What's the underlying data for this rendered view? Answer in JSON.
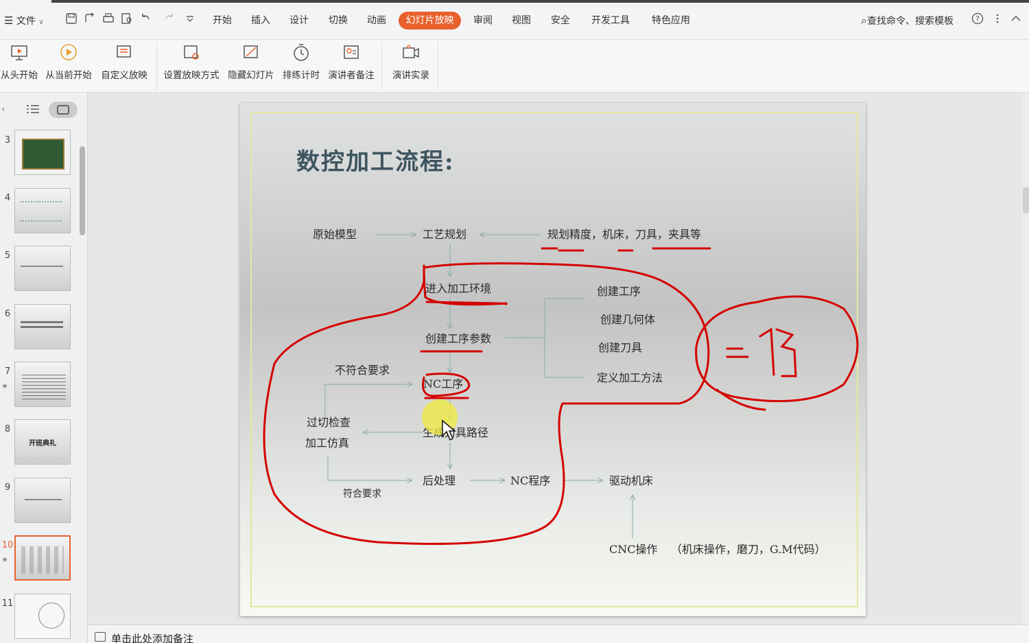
{
  "menubar": {
    "file_label": "文件",
    "tabs": [
      "开始",
      "插入",
      "设计",
      "切换",
      "动画",
      "幻灯片放映",
      "审阅",
      "视图",
      "安全",
      "开发工具",
      "特色应用"
    ],
    "active_tab": "幻灯片放映",
    "search_label": "查找命令、搜索模板"
  },
  "ribbon": {
    "buttons": [
      "从头开始",
      "从当前开始",
      "自定义放映",
      "设置放映方式",
      "隐藏幻灯片",
      "排练计时",
      "演讲者备注",
      "演讲实录"
    ]
  },
  "thumbnails": {
    "numbers": [
      "3",
      "4",
      "5",
      "6",
      "7",
      "8",
      "9",
      "10",
      "11"
    ],
    "active": "10",
    "slide8_text": "开班典礼"
  },
  "slide": {
    "title": "数控加工流程:",
    "nodes": {
      "raw_model": "原始模型",
      "process_plan": "工艺规划",
      "plan_items": "规划精度，机床，刀具，夹具等",
      "enter_env": "进入加工环境",
      "create_op_params": "创建工序参数",
      "create_op": "创建工序",
      "create_geom": "创建几何体",
      "create_tool": "创建刀具",
      "define_method": "定义加工方法",
      "not_meet": "不符合要求",
      "nc_op": "NC工序",
      "overcut": "过切检查",
      "machining_sim": "加工仿真",
      "gen_toolpath": "生成刀具路径",
      "post_process": "后处理",
      "nc_program": "NC程序",
      "drive_machine": "驱动机床",
      "meet": "符合要求",
      "cnc_op": "CNC操作",
      "cnc_detail": "（机床操作，磨刀，G.M代码）"
    }
  },
  "notes": {
    "placeholder": "单击此处添加备注"
  },
  "colors": {
    "accent": "#e8612c",
    "title": "#3d5560",
    "annotation_red": "#d40000"
  }
}
